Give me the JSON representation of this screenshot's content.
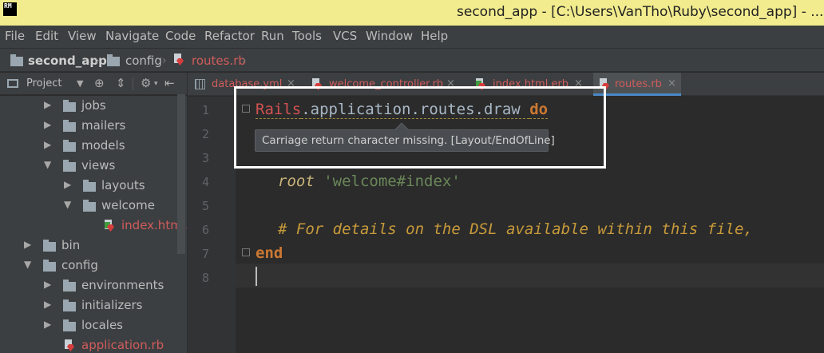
{
  "window": {
    "app_icon_text": "RM",
    "title": "second_app - [C:\\Users\\VanTho\\Ruby\\second_app] - ..."
  },
  "menu": [
    {
      "label": "File"
    },
    {
      "label": "Edit"
    },
    {
      "label": "View"
    },
    {
      "label": "Navigate"
    },
    {
      "label": "Code"
    },
    {
      "label": "Refactor"
    },
    {
      "label": "Run"
    },
    {
      "label": "Tools"
    },
    {
      "label": "VCS"
    },
    {
      "label": "Window"
    },
    {
      "label": "Help"
    }
  ],
  "breadcrumb": {
    "project": "second_app",
    "folder": "config",
    "file": "routes.rb"
  },
  "project_panel": {
    "view_label": "Project",
    "icons": [
      "dropdown-icon",
      "locate-icon",
      "collapse-icon",
      "settings-icon",
      "hide-icon"
    ]
  },
  "tree": [
    {
      "label": "jobs",
      "expanded": false
    },
    {
      "label": "mailers",
      "expanded": false
    },
    {
      "label": "models",
      "expanded": false
    },
    {
      "label": "views",
      "expanded": true
    },
    {
      "label": "layouts",
      "expanded": false
    },
    {
      "label": "welcome",
      "expanded": true
    },
    {
      "label": "index.html.e"
    },
    {
      "label": "bin",
      "expanded": false
    },
    {
      "label": "config",
      "expanded": true
    },
    {
      "label": "environments",
      "expanded": false
    },
    {
      "label": "initializers",
      "expanded": false
    },
    {
      "label": "locales",
      "expanded": false
    },
    {
      "label": "application.rb"
    }
  ],
  "tabs": [
    {
      "label": "database.yml"
    },
    {
      "label": "welcome_controller.rb"
    },
    {
      "label": "index.html.erb"
    },
    {
      "label": "routes.rb",
      "active": true
    }
  ],
  "editor": {
    "line_numbers": [
      "1",
      "2",
      "3",
      "4",
      "5",
      "6",
      "7",
      "8"
    ],
    "line1": {
      "rails": "Rails",
      "rest": ".application.routes.draw ",
      "kw": "do"
    },
    "line4": {
      "method": "root ",
      "string": "'welcome#index'"
    },
    "line6": {
      "comment": "# For details on the DSL available within this file,"
    },
    "line7": {
      "kw": "end"
    },
    "tooltip": "Carriage return character missing. [Layout/EndOfLine]"
  },
  "colors": {
    "title_bar": "#f2ec8e",
    "keyword": "#cc7832",
    "string": "#6a8759",
    "comment": "#808080",
    "constant": "#d25252",
    "active_tab_underline": "#4a88c7"
  }
}
